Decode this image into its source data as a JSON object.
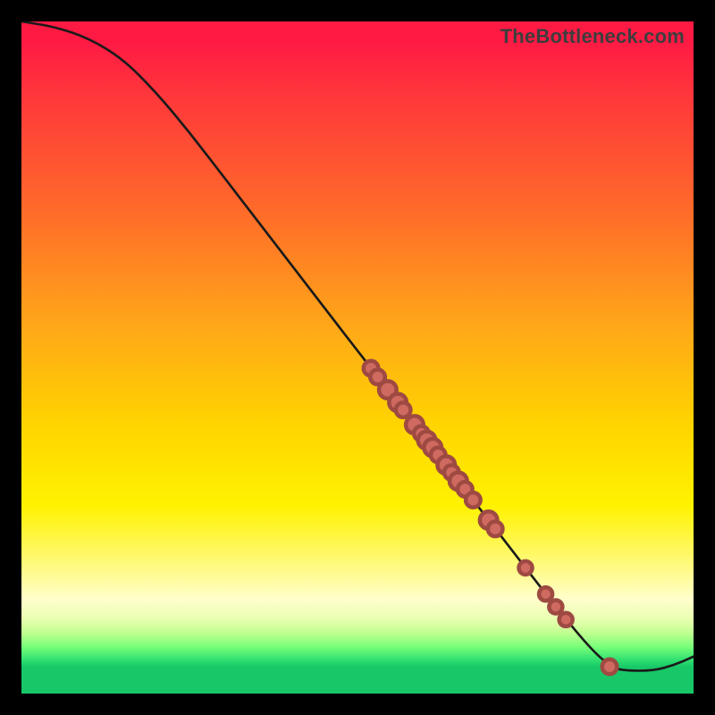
{
  "watermark": "TheBottleneck.com",
  "colors": {
    "background": "#000000",
    "curve": "#1a1a1a",
    "dot_fill": "#cf6a60",
    "dot_stroke": "#9e4a42"
  },
  "chart_data": {
    "type": "line",
    "title": "",
    "xlabel": "",
    "ylabel": "",
    "xlim": [
      0,
      100
    ],
    "ylim": [
      0,
      100
    ],
    "grid": false,
    "legend": false,
    "curve": [
      {
        "x": 0,
        "y": 100.0
      },
      {
        "x": 5,
        "y": 99.2
      },
      {
        "x": 10,
        "y": 97.5
      },
      {
        "x": 15,
        "y": 94.5
      },
      {
        "x": 20,
        "y": 89.5
      },
      {
        "x": 25,
        "y": 83.5
      },
      {
        "x": 30,
        "y": 77.0
      },
      {
        "x": 35,
        "y": 70.5
      },
      {
        "x": 40,
        "y": 64.0
      },
      {
        "x": 45,
        "y": 57.5
      },
      {
        "x": 50,
        "y": 51.0
      },
      {
        "x": 55,
        "y": 44.6
      },
      {
        "x": 60,
        "y": 38.1
      },
      {
        "x": 65,
        "y": 31.6
      },
      {
        "x": 70,
        "y": 25.2
      },
      {
        "x": 75,
        "y": 18.7
      },
      {
        "x": 80,
        "y": 12.3
      },
      {
        "x": 85,
        "y": 6.3
      },
      {
        "x": 88,
        "y": 3.8
      },
      {
        "x": 90,
        "y": 3.4
      },
      {
        "x": 94,
        "y": 3.4
      },
      {
        "x": 97,
        "y": 4.2
      },
      {
        "x": 100,
        "y": 5.5
      }
    ],
    "points": [
      {
        "x": 52.0,
        "y": 48.4,
        "r": 1.1
      },
      {
        "x": 53.0,
        "y": 47.1,
        "r": 1.1
      },
      {
        "x": 54.5,
        "y": 45.2,
        "r": 1.3
      },
      {
        "x": 56.0,
        "y": 43.3,
        "r": 1.3
      },
      {
        "x": 56.8,
        "y": 42.2,
        "r": 1.1
      },
      {
        "x": 58.5,
        "y": 40.0,
        "r": 1.3
      },
      {
        "x": 59.5,
        "y": 38.7,
        "r": 1.1
      },
      {
        "x": 60.3,
        "y": 37.7,
        "r": 1.3
      },
      {
        "x": 61.2,
        "y": 36.6,
        "r": 1.3
      },
      {
        "x": 62.0,
        "y": 35.5,
        "r": 1.1
      },
      {
        "x": 63.2,
        "y": 34.0,
        "r": 1.3
      },
      {
        "x": 64.0,
        "y": 32.9,
        "r": 1.1
      },
      {
        "x": 65.0,
        "y": 31.6,
        "r": 1.3
      },
      {
        "x": 66.0,
        "y": 30.4,
        "r": 1.1
      },
      {
        "x": 67.2,
        "y": 28.8,
        "r": 1.1
      },
      {
        "x": 69.5,
        "y": 25.8,
        "r": 1.3
      },
      {
        "x": 70.5,
        "y": 24.5,
        "r": 1.1
      },
      {
        "x": 75.0,
        "y": 18.7,
        "r": 1.0
      },
      {
        "x": 78.0,
        "y": 14.8,
        "r": 1.0
      },
      {
        "x": 79.5,
        "y": 12.9,
        "r": 1.0
      },
      {
        "x": 81.0,
        "y": 11.0,
        "r": 1.0
      },
      {
        "x": 87.5,
        "y": 4.0,
        "r": 1.1
      }
    ]
  }
}
